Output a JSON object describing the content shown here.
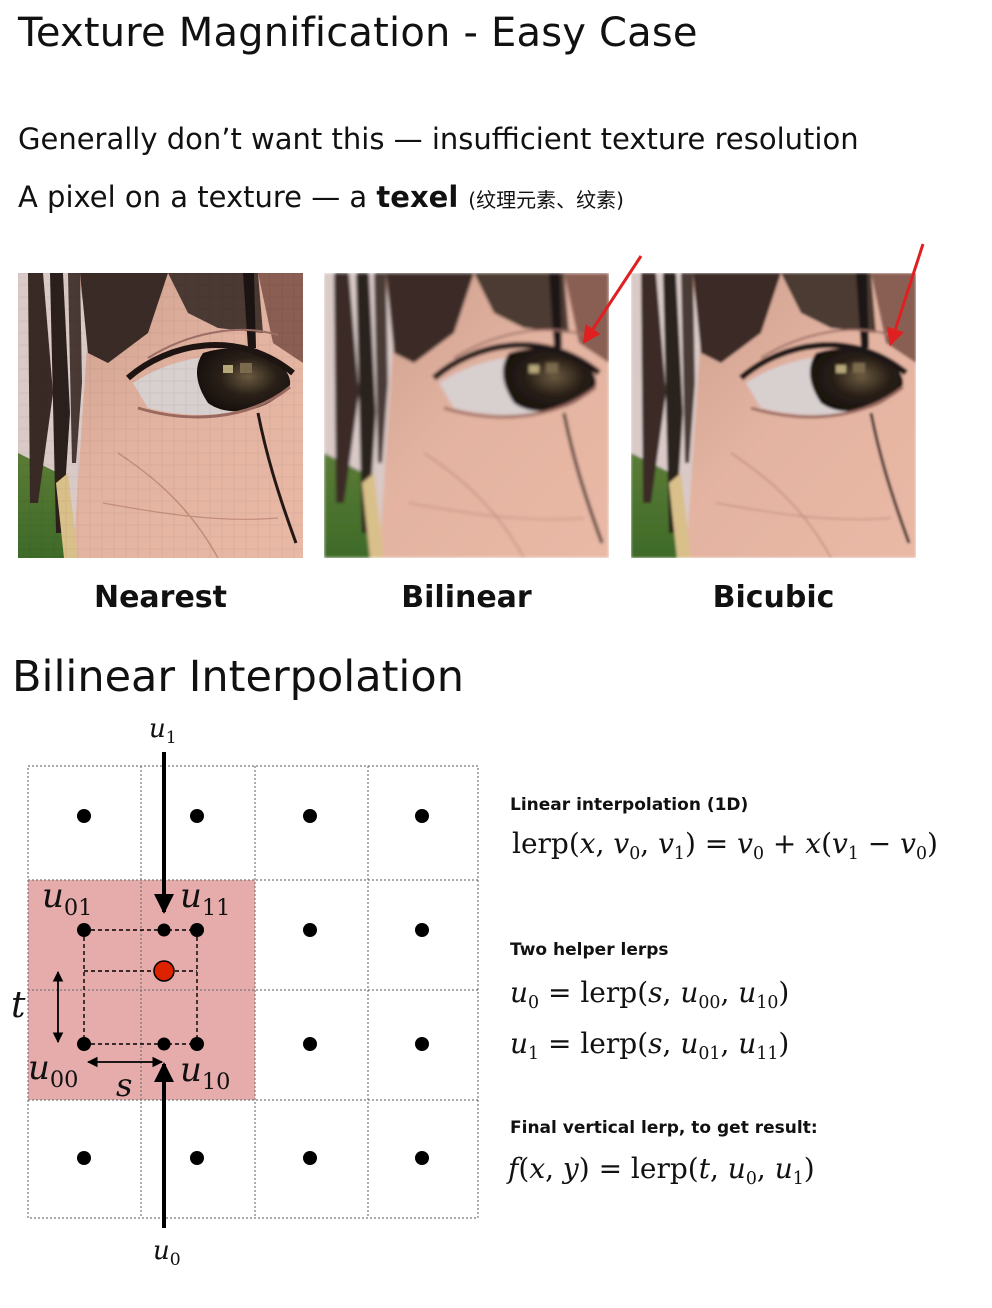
{
  "header": {
    "title": "Texture Magnification - Easy Case",
    "line1": "Generally don’t want this — insufficient texture resolution",
    "line2_prefix": "A pixel on a texture — a ",
    "line2_bold": "texel",
    "line2_chinese": "(纹理元素、纹素)"
  },
  "images": [
    {
      "label": "Nearest",
      "has_arrow": false
    },
    {
      "label": "Bilinear",
      "has_arrow": true
    },
    {
      "label": "Bicubic",
      "has_arrow": true
    }
  ],
  "colors": {
    "arrow": "#e02020",
    "highlight": "#e6acac",
    "sample_point": "#dd2200"
  },
  "section_title": "Bilinear Interpolation",
  "diagram": {
    "top_label": "u1",
    "bottom_label": "u0",
    "corner_labels": {
      "u01": "u01",
      "u11": "u11",
      "u00": "u00",
      "u10": "u10"
    },
    "t_label": "t",
    "s_label": "s"
  },
  "formulas": {
    "lerp_heading": "Linear interpolation (1D)",
    "lerp": "lerp(x, v0, v1) = v0 + x(v1 − v0)",
    "helpers_heading": "Two helper lerps",
    "helper_u0": "u0 = lerp(s, u00, u10)",
    "helper_u1": "u1 = lerp(s, u01, u11)",
    "final_heading": "Final vertical lerp, to get result:",
    "final": "f(x, y) = lerp(t, u0, u1)"
  }
}
